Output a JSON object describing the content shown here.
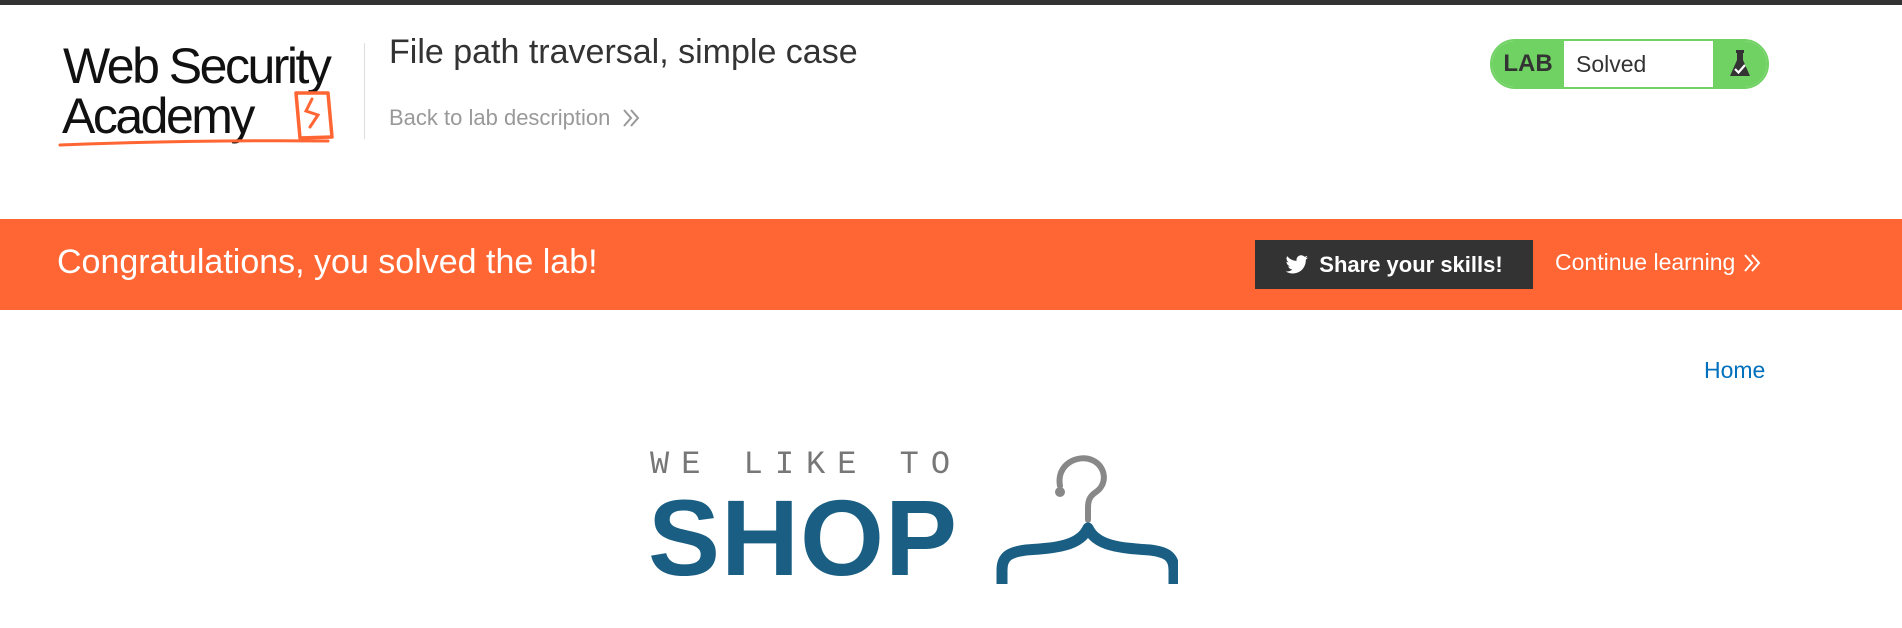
{
  "header": {
    "logo": {
      "line1": "Web Security",
      "line2": "Academy"
    },
    "lab_title": "File path traversal, simple case",
    "back_link": "Back to lab description",
    "badge": {
      "tag": "LAB",
      "status": "Solved",
      "color": "#70d263"
    }
  },
  "banner": {
    "message": "Congratulations, you solved the lab!",
    "share_label": "Share your skills!",
    "continue_label": "Continue learning",
    "color": "#ff6633"
  },
  "nav": {
    "home": "Home"
  },
  "shop_logo": {
    "tagline": "WE LIKE TO",
    "name": "SHOP"
  },
  "icons": [
    "logo-mark-icon",
    "double-chevron-right-icon",
    "flask-icon",
    "twitter-icon",
    "hanger-icon"
  ]
}
